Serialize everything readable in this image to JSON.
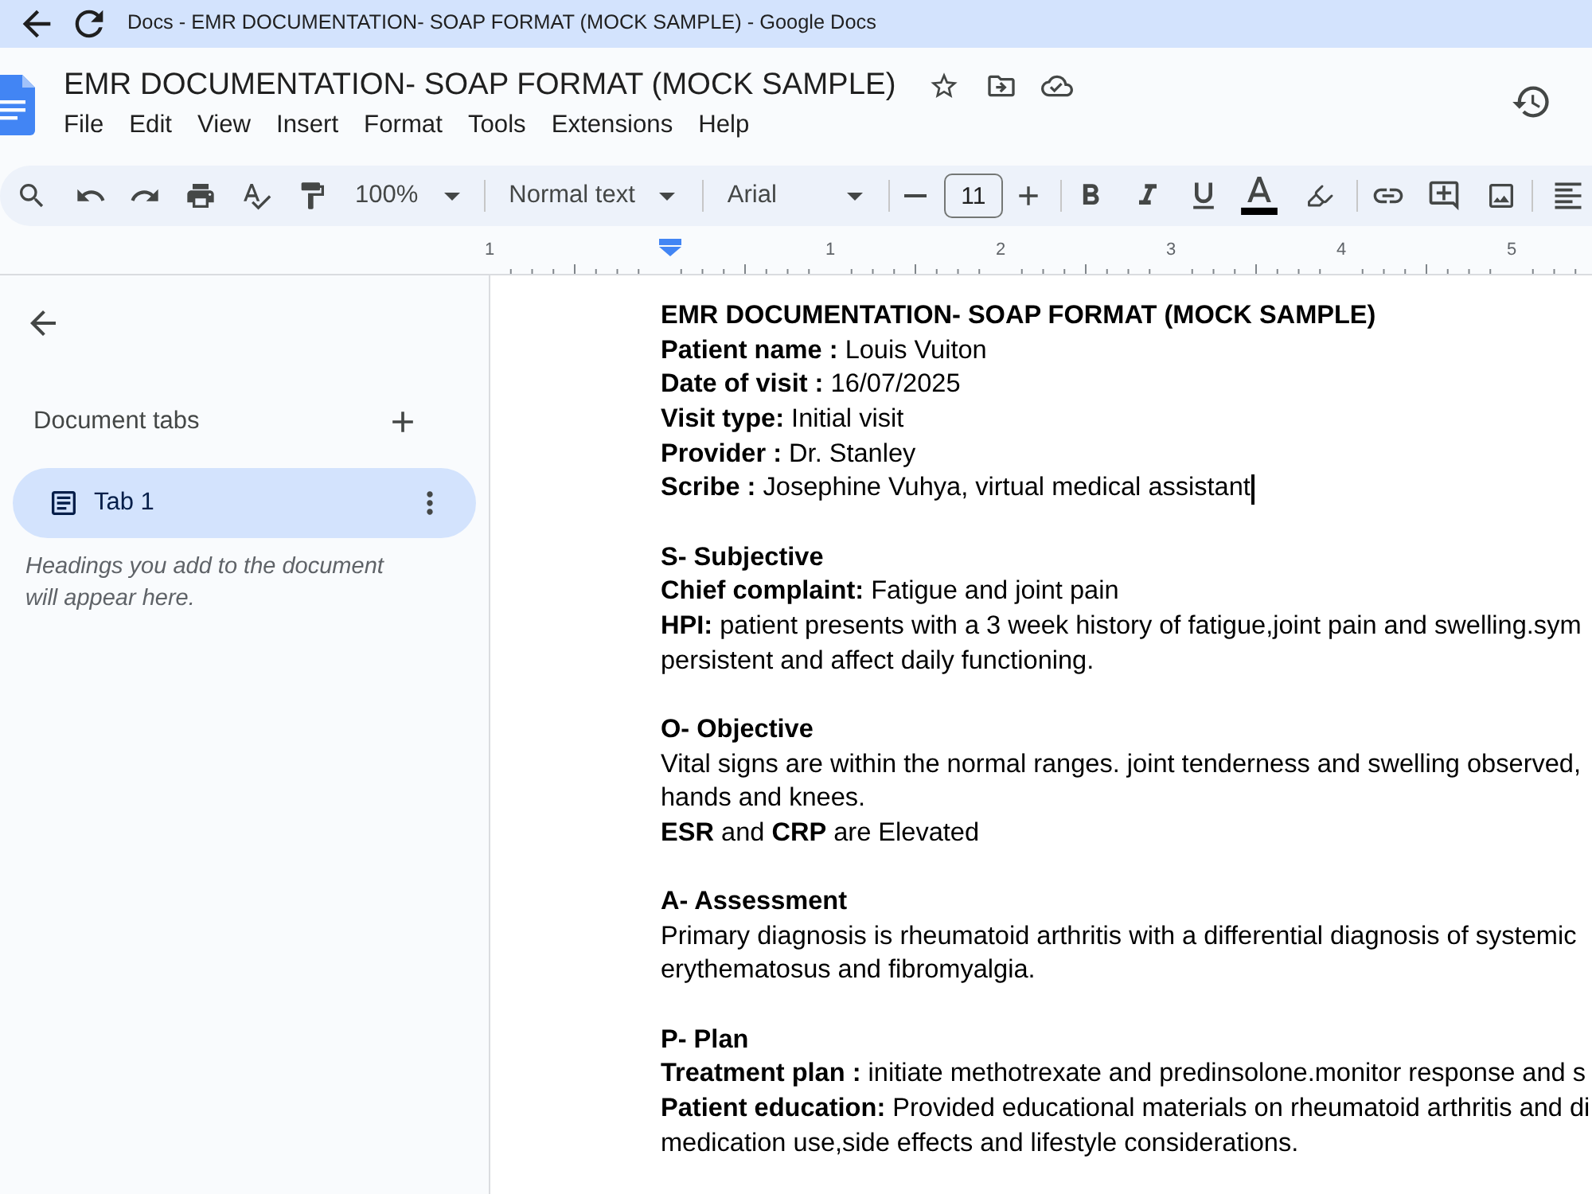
{
  "browser": {
    "page_title": "Docs - EMR DOCUMENTATION- SOAP FORMAT (MOCK SAMPLE) - Google Docs"
  },
  "header": {
    "document_name": "EMR DOCUMENTATION- SOAP FORMAT (MOCK SAMPLE)",
    "menu": [
      "File",
      "Edit",
      "View",
      "Insert",
      "Format",
      "Tools",
      "Extensions",
      "Help"
    ]
  },
  "toolbar": {
    "zoom": "100%",
    "paragraph_style": "Normal text",
    "font": "Arial",
    "font_size": "11"
  },
  "ruler": {
    "labels": [
      "1",
      "1",
      "2",
      "3",
      "4",
      "5"
    ]
  },
  "sidebar": {
    "title": "Document tabs",
    "tabs": [
      {
        "label": "Tab 1",
        "selected": true
      }
    ],
    "hint": "Headings you add to the document will appear here."
  },
  "document": {
    "sections": [
      {
        "paragraphs": [
          {
            "kind": "heading",
            "lines": [
              "EMR DOCUMENTATION- SOAP FORMAT (MOCK SAMPLE)"
            ],
            "cursor": false
          },
          {
            "kind": "text",
            "lines": [
              "**Patient name :** Louis Vuiton"
            ],
            "cursor": false
          },
          {
            "kind": "text",
            "lines": [
              "**Date of visit :** 16/07/2025"
            ],
            "cursor": false
          },
          {
            "kind": "text",
            "lines": [
              "**Visit type:** Initial visit"
            ],
            "cursor": false
          },
          {
            "kind": "text",
            "lines": [
              "**Provider :** Dr. Stanley"
            ],
            "cursor": false
          },
          {
            "kind": "text",
            "lines": [
              "**Scribe :** Josephine Vuhya, virtual medical assistant"
            ],
            "cursor": true
          }
        ]
      },
      {
        "paragraphs": [
          {
            "kind": "heading",
            "lines": [
              "S- Subjective"
            ],
            "cursor": false
          },
          {
            "kind": "text",
            "lines": [
              "**Chief complaint:** Fatigue and joint pain"
            ],
            "cursor": false
          },
          {
            "kind": "text",
            "lines": [
              "**HPI:** patient presents with a 3 week history of fatigue,joint pain and swelling.sym",
              "persistent and affect daily functioning."
            ],
            "cursor": false
          }
        ]
      },
      {
        "paragraphs": [
          {
            "kind": "heading",
            "lines": [
              "O- Objective"
            ],
            "cursor": false
          },
          {
            "kind": "text",
            "lines": [
              "Vital signs are within the normal ranges. joint tenderness and swelling observed,",
              "hands and knees."
            ],
            "cursor": false
          },
          {
            "kind": "text",
            "lines": [
              "**ESR** and **CRP** are Elevated"
            ],
            "cursor": false
          }
        ]
      },
      {
        "paragraphs": [
          {
            "kind": "heading",
            "lines": [
              "A- Assessment"
            ],
            "cursor": false
          },
          {
            "kind": "text",
            "lines": [
              "Primary diagnosis is rheumatoid arthritis with a differential diagnosis of systemic",
              "erythematosus and fibromyalgia."
            ],
            "cursor": false
          }
        ]
      },
      {
        "paragraphs": [
          {
            "kind": "heading",
            "lines": [
              "P- Plan"
            ],
            "cursor": false
          },
          {
            "kind": "text",
            "lines": [
              "**Treatment plan :** initiate methotrexate and predinsolone.monitor response and s"
            ],
            "cursor": false
          },
          {
            "kind": "text",
            "lines": [
              "**Patient education:** Provided educational materials on rheumatoid arthritis and di",
              "medication use,side effects and lifestyle considerations."
            ],
            "cursor": false
          }
        ]
      }
    ]
  }
}
